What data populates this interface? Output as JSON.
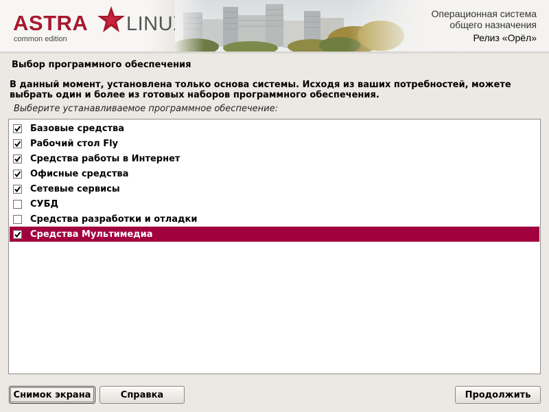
{
  "banner": {
    "brand": "ASTRA",
    "brand_suffix": "LINUX",
    "edition": "common edition",
    "os_line1": "Операционная система",
    "os_line2": "общего назначения",
    "release": "Релиз «Орёл»",
    "brand_color": "#a6192e"
  },
  "page": {
    "title": "Выбор программного обеспечения",
    "description": "В данный момент, установлена только основа системы. Исходя из ваших потребностей, можете выбрать один и более из готовых наборов программного обеспечения.",
    "prompt": "Выберите устанавливаемое программное обеспечение:"
  },
  "software_list": {
    "items": [
      {
        "label": "Базовые средства",
        "checked": true,
        "selected": false
      },
      {
        "label": "Рабочий стол Fly",
        "checked": true,
        "selected": false
      },
      {
        "label": "Средства работы в Интернет",
        "checked": true,
        "selected": false
      },
      {
        "label": "Офисные средства",
        "checked": true,
        "selected": false
      },
      {
        "label": "Сетевые сервисы",
        "checked": true,
        "selected": false
      },
      {
        "label": "СУБД",
        "checked": false,
        "selected": false
      },
      {
        "label": "Средства разработки и отладки",
        "checked": false,
        "selected": false
      },
      {
        "label": "Средства Мультимедиа",
        "checked": true,
        "selected": true
      }
    ],
    "selection_color": "#a2013f"
  },
  "buttons": {
    "screenshot": "Снимок экрана",
    "help": "Справка",
    "continue": "Продолжить"
  }
}
